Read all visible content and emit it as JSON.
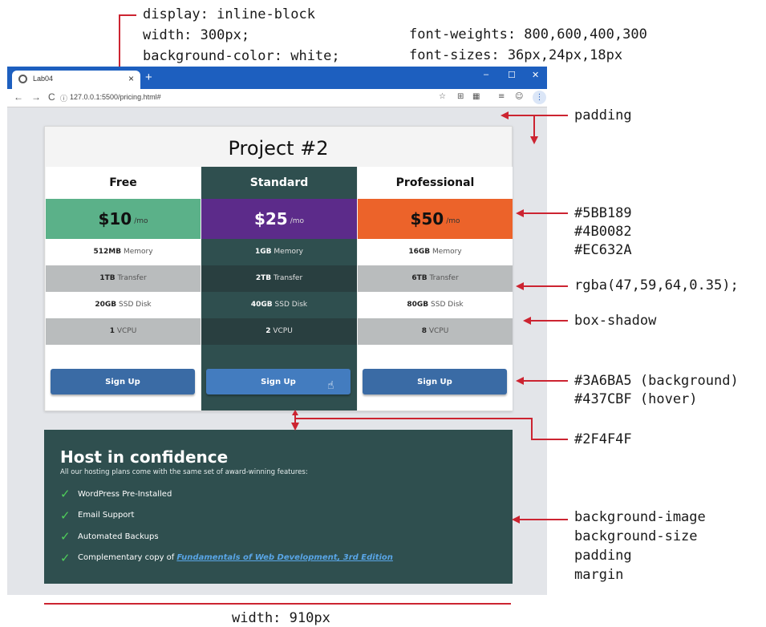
{
  "annotations": {
    "display": "display: inline-block",
    "width300": "width: 300px;",
    "bgwhite": "background-color: white;",
    "fontweights": "font-weights: 800,600,400,300",
    "fontsizes": "font-sizes: 36px,24px,18px",
    "padding": "padding",
    "colors": [
      "#5BB189",
      "#4B0082",
      "#EC632A"
    ],
    "rgba": "rgba(47,59,64,0.35);",
    "boxshadow": "box-shadow",
    "btn_bg": "#3A6BA5 (background)",
    "btn_hover": "#437CBF (hover)",
    "gap_color": "#2F4F4F",
    "bg_props": [
      "background-image",
      "background-size",
      "padding",
      "margin"
    ],
    "width910": "width: 910px"
  },
  "browser": {
    "tab_title": "Lab04",
    "tab_close": "×",
    "new_tab": "+",
    "url": "127.0.0.1:5500/pricing.html#",
    "win_min": "–",
    "win_max": "☐",
    "win_close": "✕"
  },
  "pricing": {
    "title": "Project #2",
    "plans": [
      {
        "name": "Free",
        "price": "$10",
        "unit": "/mo",
        "rows": [
          {
            "value": "512MB",
            "label": "Memory"
          },
          {
            "value": "1TB",
            "label": "Transfer"
          },
          {
            "value": "20GB",
            "label": "SSD Disk"
          },
          {
            "value": "1",
            "label": "VCPU"
          }
        ],
        "button": "Sign Up"
      },
      {
        "name": "Standard",
        "price": "$25",
        "unit": "/mo",
        "rows": [
          {
            "value": "1GB",
            "label": "Memory"
          },
          {
            "value": "2TB",
            "label": "Transfer"
          },
          {
            "value": "40GB",
            "label": "SSD Disk"
          },
          {
            "value": "2",
            "label": "VCPU"
          }
        ],
        "button": "Sign Up"
      },
      {
        "name": "Professional",
        "price": "$50",
        "unit": "/mo",
        "rows": [
          {
            "value": "16GB",
            "label": "Memory"
          },
          {
            "value": "6TB",
            "label": "Transfer"
          },
          {
            "value": "80GB",
            "label": "SSD Disk"
          },
          {
            "value": "8",
            "label": "VCPU"
          }
        ],
        "button": "Sign Up"
      }
    ]
  },
  "host": {
    "title": "Host in confidence",
    "subtitle": "All our hosting plans come with the same set of award-winning features:",
    "features": [
      "WordPress Pre-Installed",
      "Email Support",
      "Automated Backups",
      "Complementary copy of"
    ],
    "book_link": "Fundamentals of Web Development, 3rd Edition"
  }
}
